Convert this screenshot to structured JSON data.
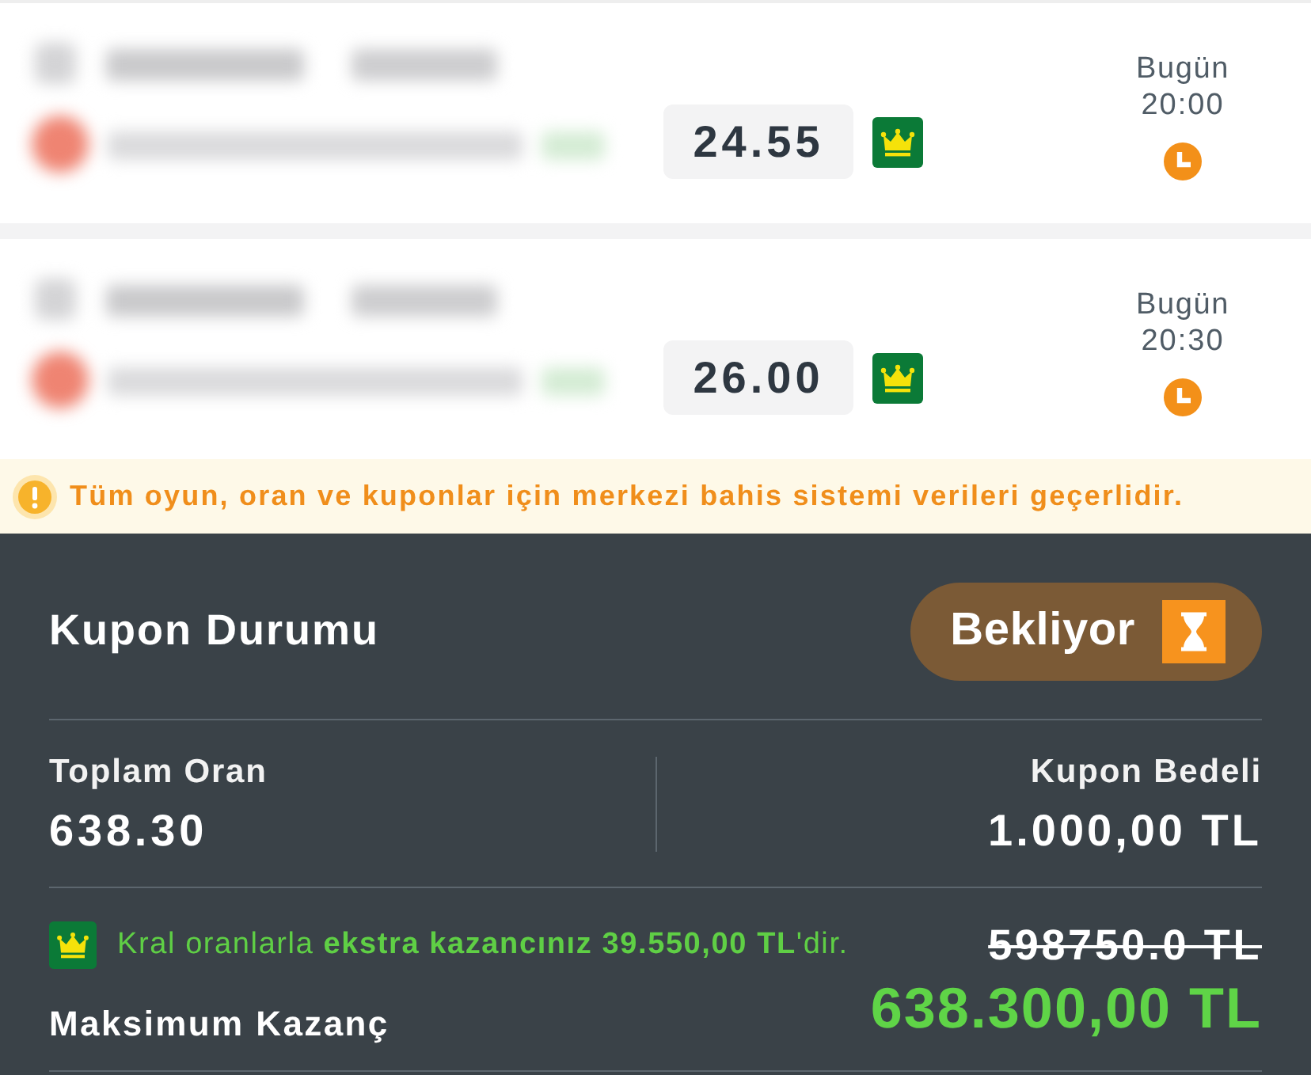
{
  "matches": [
    {
      "odds": "24.55",
      "king_odds": true,
      "day": "Bugün",
      "time": "20:00"
    },
    {
      "odds": "26.00",
      "king_odds": true,
      "day": "Bugün",
      "time": "20:30"
    }
  ],
  "notice": {
    "text": "Tüm oyun, oran ve kuponlar için merkezi bahis sistemi verileri geçerlidir."
  },
  "coupon": {
    "title": "Kupon Durumu",
    "status": {
      "label": "Bekliyor",
      "kind": "pending"
    },
    "total_odds": {
      "label": "Toplam Oran",
      "value": "638.30"
    },
    "stake": {
      "label": "Kupon Bedeli",
      "value": "1.000,00 TL"
    },
    "bonus_note": "Kral oranlarla **ekstra kazancınız 39.550,00 TL**'dir.",
    "old_max_win": "598750.0 TL",
    "max_win": {
      "label": "Maksimum Kazanç",
      "value": "638.300,00 TL"
    }
  }
}
